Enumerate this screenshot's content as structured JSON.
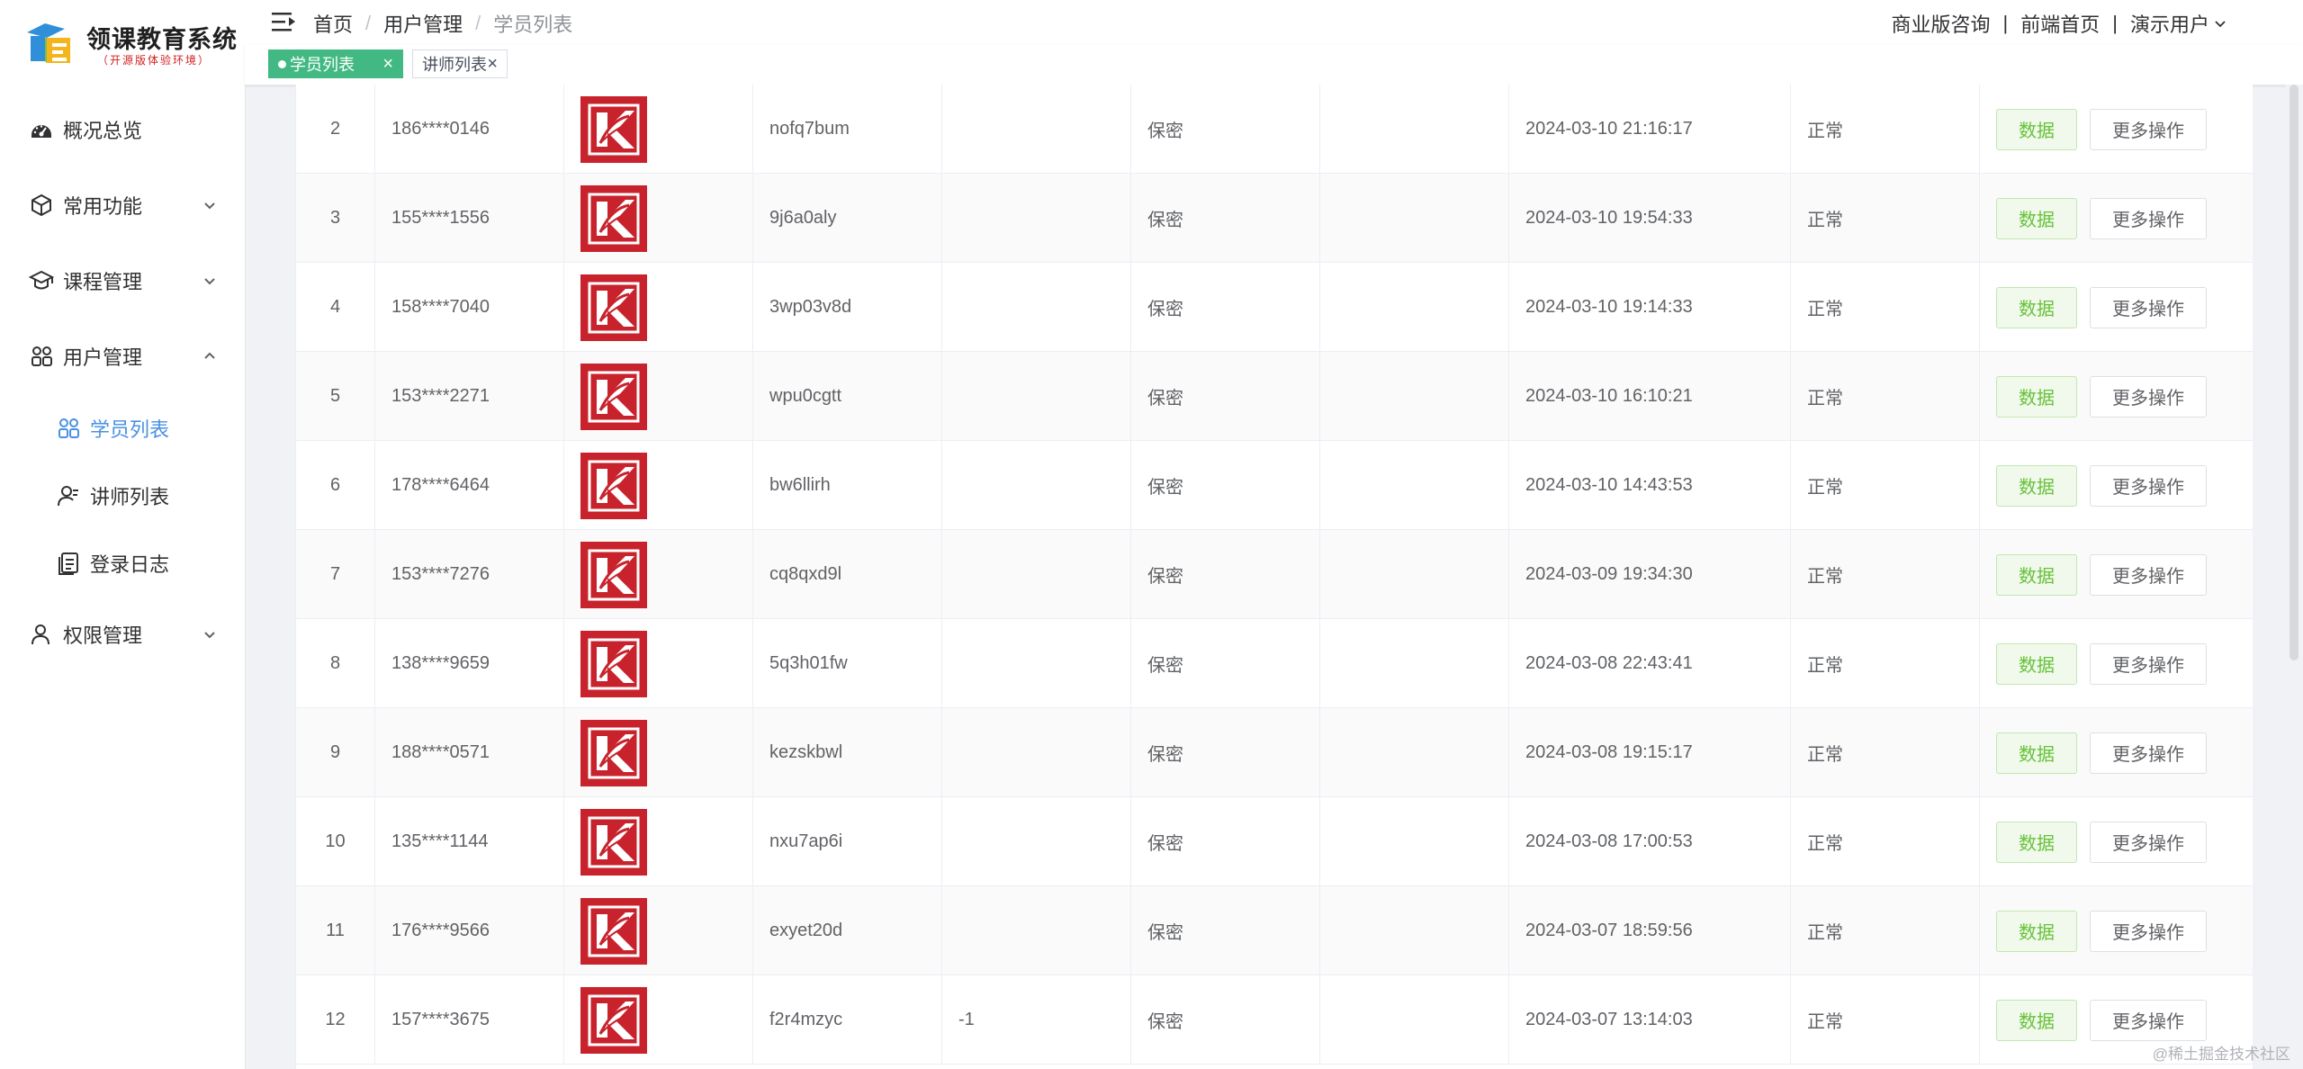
{
  "logo": {
    "title": "领课教育系统",
    "subtitle": "（开源版体验环境）"
  },
  "sidebar": {
    "items": [
      {
        "label": "概况总览",
        "icon": "dashboard-icon",
        "arrow": ""
      },
      {
        "label": "常用功能",
        "icon": "cube-icon",
        "arrow": "down"
      },
      {
        "label": "课程管理",
        "icon": "graduation-cap-icon",
        "arrow": "down"
      },
      {
        "label": "用户管理",
        "icon": "users-icon",
        "arrow": "up"
      }
    ],
    "subitems": [
      {
        "label": "学员列表",
        "icon": "students-icon",
        "active": true
      },
      {
        "label": "讲师列表",
        "icon": "teacher-icon",
        "active": false
      },
      {
        "label": "登录日志",
        "icon": "log-icon",
        "active": false
      }
    ],
    "bottom_item": {
      "label": "权限管理",
      "icon": "user-lock-icon",
      "arrow": "down"
    }
  },
  "header": {
    "breadcrumb": [
      "首页",
      "用户管理",
      "学员列表"
    ],
    "links": [
      "商业版咨询",
      "前端首页"
    ],
    "user_menu": "演示用户"
  },
  "tags": [
    {
      "label": "学员列表",
      "active": true
    },
    {
      "label": "讲师列表",
      "active": false
    }
  ],
  "table": {
    "data_button": "数据",
    "more_button": "更多操作",
    "rows": [
      {
        "idx": "2",
        "phone": "186****0146",
        "nick": "nofq7bum",
        "extra": "",
        "gender": "保密",
        "time": "2024-03-10 21:16:17",
        "status": "正常"
      },
      {
        "idx": "3",
        "phone": "155****1556",
        "nick": "9j6a0aly",
        "extra": "",
        "gender": "保密",
        "time": "2024-03-10 19:54:33",
        "status": "正常"
      },
      {
        "idx": "4",
        "phone": "158****7040",
        "nick": "3wp03v8d",
        "extra": "",
        "gender": "保密",
        "time": "2024-03-10 19:14:33",
        "status": "正常"
      },
      {
        "idx": "5",
        "phone": "153****2271",
        "nick": "wpu0cgtt",
        "extra": "",
        "gender": "保密",
        "time": "2024-03-10 16:10:21",
        "status": "正常"
      },
      {
        "idx": "6",
        "phone": "178****6464",
        "nick": "bw6llirh",
        "extra": "",
        "gender": "保密",
        "time": "2024-03-10 14:43:53",
        "status": "正常"
      },
      {
        "idx": "7",
        "phone": "153****7276",
        "nick": "cq8qxd9l",
        "extra": "",
        "gender": "保密",
        "time": "2024-03-09 19:34:30",
        "status": "正常"
      },
      {
        "idx": "8",
        "phone": "138****9659",
        "nick": "5q3h01fw",
        "extra": "",
        "gender": "保密",
        "time": "2024-03-08 22:43:41",
        "status": "正常"
      },
      {
        "idx": "9",
        "phone": "188****0571",
        "nick": "kezskbwl",
        "extra": "",
        "gender": "保密",
        "time": "2024-03-08 19:15:17",
        "status": "正常"
      },
      {
        "idx": "10",
        "phone": "135****1144",
        "nick": "nxu7ap6i",
        "extra": "",
        "gender": "保密",
        "time": "2024-03-08 17:00:53",
        "status": "正常"
      },
      {
        "idx": "11",
        "phone": "176****9566",
        "nick": "exyet20d",
        "extra": "",
        "gender": "保密",
        "time": "2024-03-07 18:59:56",
        "status": "正常"
      },
      {
        "idx": "12",
        "phone": "157****3675",
        "nick": "f2r4mzyc",
        "extra": "-1",
        "gender": "保密",
        "time": "2024-03-07 13:14:03",
        "status": "正常"
      }
    ]
  },
  "watermark": "@稀土掘金技术社区",
  "colors": {
    "accent": "#42b983",
    "active_menu": "#4a90e2",
    "avatar_red": "#c8232c",
    "data_green": "#67c23a"
  }
}
